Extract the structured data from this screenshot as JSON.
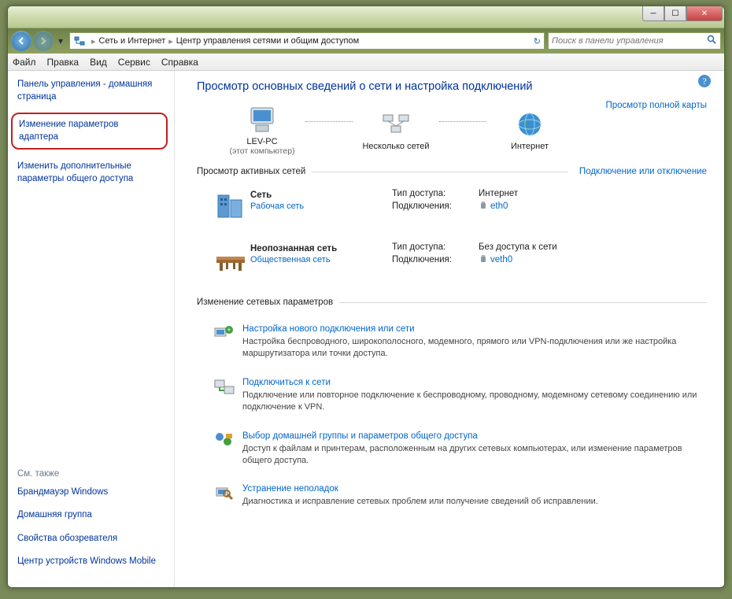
{
  "titlebar": {
    "min": "─",
    "max": "☐",
    "close": "✕"
  },
  "breadcrumb": {
    "level1": "Сеть и Интернет",
    "level2": "Центр управления сетями и общим доступом"
  },
  "search": {
    "placeholder": "Поиск в панели управления"
  },
  "menu": {
    "file": "Файл",
    "edit": "Правка",
    "view": "Вид",
    "tools": "Сервис",
    "help": "Справка"
  },
  "sidebar": {
    "home": "Панель управления - домашняя страница",
    "adapter": "Изменение параметров адаптера",
    "sharing": "Изменить дополнительные параметры общего доступа",
    "see_also": "См. также",
    "firewall": "Брандмауэр Windows",
    "homegroup": "Домашняя группа",
    "ie": "Свойства обозревателя",
    "mobile": "Центр устройств Windows Mobile"
  },
  "content": {
    "heading": "Просмотр основных сведений о сети и настройка подключений",
    "fullmap": "Просмотр полной карты",
    "node_pc": "LEV-PC",
    "node_pc_sub": "(этот компьютер)",
    "node_multi": "Несколько сетей",
    "node_internet": "Интернет",
    "active_hdr": "Просмотр активных сетей",
    "connect_link": "Подключение или отключение",
    "change_hdr": "Изменение сетевых параметров",
    "net1": {
      "name": "Сеть",
      "type": "Рабочая сеть",
      "access_lbl": "Тип доступа:",
      "access_val": "Интернет",
      "conn_lbl": "Подключения:",
      "conn_val": "eth0"
    },
    "net2": {
      "name": "Неопознанная сеть",
      "type": "Общественная сеть",
      "access_lbl": "Тип доступа:",
      "access_val": "Без доступа к сети",
      "conn_lbl": "Подключения:",
      "conn_val": "veth0"
    },
    "tasks": [
      {
        "link": "Настройка нового подключения или сети",
        "desc": "Настройка беспроводного, широкополосного, модемного, прямого или VPN-подключения или же настройка маршрутизатора или точки доступа."
      },
      {
        "link": "Подключиться к сети",
        "desc": "Подключение или повторное подключение к беспроводному, проводному, модемному сетевому соединению или подключение к VPN."
      },
      {
        "link": "Выбор домашней группы и параметров общего доступа",
        "desc": "Доступ к файлам и принтерам, расположенным на других сетевых компьютерах, или изменение параметров общего доступа."
      },
      {
        "link": "Устранение неполадок",
        "desc": "Диагностика и исправление сетевых проблем или получение сведений об исправлении."
      }
    ]
  }
}
